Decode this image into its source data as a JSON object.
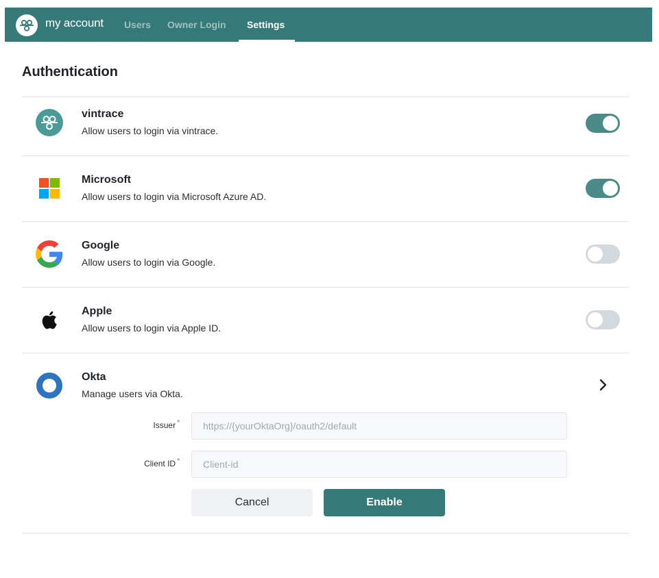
{
  "nav": {
    "brand": "my account",
    "brand_icon": "vintrace-logo-icon",
    "links": [
      {
        "label": "Users",
        "active": false
      },
      {
        "label": "Owner Login",
        "active": false
      },
      {
        "label": "Settings",
        "active": true
      }
    ],
    "bar_color": "#357a78"
  },
  "page": {
    "title": "Authentication"
  },
  "providers": [
    {
      "name": "vintrace",
      "description": "Allow users to login via vintrace.",
      "icon": "vintrace-icon",
      "enabled": true
    },
    {
      "name": "Microsoft",
      "description": "Allow users to login via Microsoft Azure AD.",
      "icon": "microsoft-icon",
      "enabled": true
    },
    {
      "name": "Google",
      "description": "Allow users to login via Google.",
      "icon": "google-icon",
      "enabled": false
    },
    {
      "name": "Apple",
      "description": "Allow users to login via Apple ID.",
      "icon": "apple-icon",
      "enabled": false
    },
    {
      "name": "Okta",
      "description": "Manage users via Okta.",
      "icon": "okta-icon",
      "expand_icon": "chevron-right-icon"
    }
  ],
  "okta_form": {
    "issuer": {
      "label": "Issuer",
      "required_mark": "*",
      "value": "",
      "placeholder": "https://{yourOktaOrg}/oauth2/default"
    },
    "client_id": {
      "label": "Client ID",
      "required_mark": "*",
      "value": "",
      "placeholder": "Client-id"
    },
    "cancel_label": "Cancel",
    "enable_label": "Enable"
  },
  "colors": {
    "accent": "#357a78",
    "toggle_on": "#4a8b88",
    "toggle_off": "#d3d8dd",
    "required": "#e5484d"
  }
}
